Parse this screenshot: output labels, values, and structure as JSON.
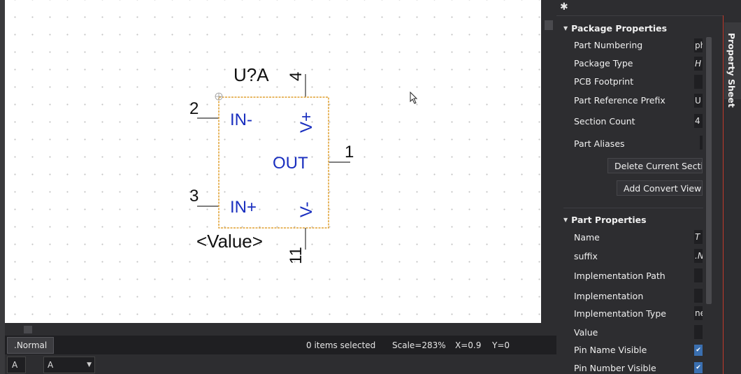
{
  "schematic": {
    "ref": "U?A",
    "value": "<Value>",
    "pins": [
      {
        "number": "4",
        "name": "V+"
      },
      {
        "number": "2",
        "name": "IN-"
      },
      {
        "number": "1",
        "name": "OUT"
      },
      {
        "number": "3",
        "name": "IN+"
      },
      {
        "number": "11",
        "name": "V-"
      }
    ]
  },
  "status": {
    "tab": ".Normal",
    "selection": "0 items selected",
    "scale": "Scale=283%",
    "x": "X=0.9",
    "y": "Y=0"
  },
  "bottom": {
    "cell": "A",
    "section_value": "A"
  },
  "panel": {
    "package": {
      "title": "Package Properties",
      "rows": [
        {
          "label": "Part Numbering",
          "value": "ph"
        },
        {
          "label": "Package Type",
          "value": "H"
        },
        {
          "label": "PCB Footprint",
          "value": ""
        },
        {
          "label": "Part Reference Prefix",
          "value": "U"
        },
        {
          "label": "Section Count",
          "value": "4"
        },
        {
          "label": "Part Aliases",
          "value": ""
        }
      ],
      "delete_button": "Delete Current Section",
      "convert_button": "Add Convert View"
    },
    "part": {
      "title": "Part Properties",
      "rows": [
        {
          "label": "Name",
          "value": "T"
        },
        {
          "label": "suffix",
          "value": ".N"
        },
        {
          "label": "Implementation Path",
          "value": ""
        },
        {
          "label": "Implementation",
          "value": ""
        },
        {
          "label": "Implementation Type",
          "value": "ne"
        },
        {
          "label": "Value",
          "value": ""
        },
        {
          "label": "Pin Name Visible",
          "value": "✔"
        },
        {
          "label": "Pin Number Visible",
          "value": "✔"
        }
      ]
    },
    "side_tab": "Property Sheet"
  },
  "colors": {
    "pin_name": "#1a2fbf",
    "body_outline": "#e0a030",
    "panel_bg": "#2d2d30",
    "accent_border": "#c0392b"
  }
}
